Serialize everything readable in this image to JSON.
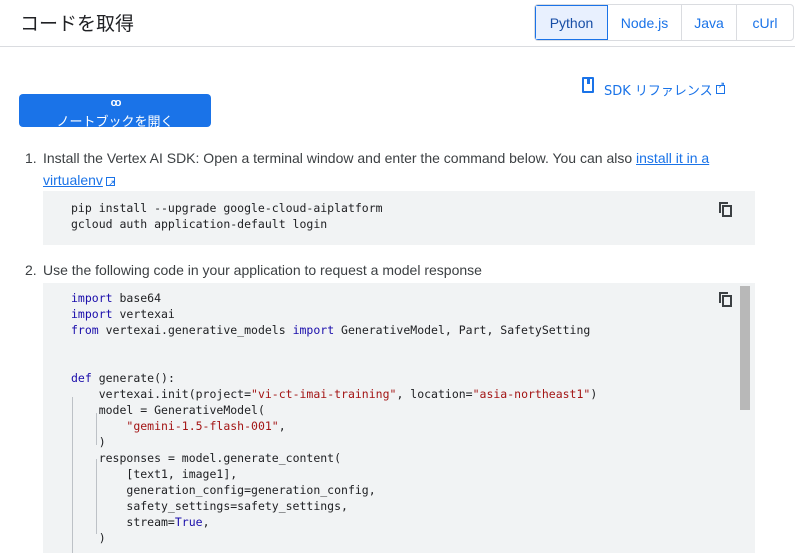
{
  "header": {
    "title": "コードを取得",
    "tabs": [
      {
        "label": "Python",
        "active": true
      },
      {
        "label": "Node.js",
        "active": false
      },
      {
        "label": "Java",
        "active": false
      },
      {
        "label": "cUrl",
        "active": false
      }
    ]
  },
  "colab": {
    "icon_text": "co",
    "label": "ノートブックを開く"
  },
  "sdk_reference": {
    "label": "SDK リファレンス",
    "icon": "book-icon"
  },
  "steps": [
    {
      "number": "1.",
      "text_before": "Install the Vertex AI SDK: Open a terminal window and enter the command below. You can also ",
      "link1": "install it in a",
      "link2": "virtualenv",
      "code": [
        "pip install --upgrade google-cloud-aiplatform",
        "gcloud auth application-default login"
      ]
    },
    {
      "number": "2.",
      "text": "Use the following code in your application to request a model response",
      "code": {
        "l1_kw": "import",
        "l1_rest": " base64",
        "l2_kw": "import",
        "l2_rest": " vertexai",
        "l3_kw1": "from",
        "l3_mid": " vertexai.generative_models ",
        "l3_kw2": "import",
        "l3_rest": " GenerativeModel, Part, SafetySetting",
        "l4_kw": "def",
        "l4_rest": " generate():",
        "l5_a": "vertexai.init(project=",
        "l5_s1": "\"vi-ct-imai-training\"",
        "l5_b": ", location=",
        "l5_s2": "\"asia-northeast1\"",
        "l5_c": ")",
        "l6": "model = GenerativeModel(",
        "l7_s": "\"gemini-1.5-flash-001\"",
        "l7_c": ",",
        "l8": ")",
        "l9": "responses = model.generate_content(",
        "l10": "[text1, image1],",
        "l11": "generation_config=generation_config,",
        "l12": "safety_settings=safety_settings,",
        "l13_a": "stream=",
        "l13_kw": "True",
        "l13_c": ",",
        "l14": ")"
      }
    }
  ],
  "colors": {
    "accent": "#1a73e8",
    "keyword": "#1a0dab",
    "string": "#a31515",
    "code_bg": "#f1f3f4"
  }
}
